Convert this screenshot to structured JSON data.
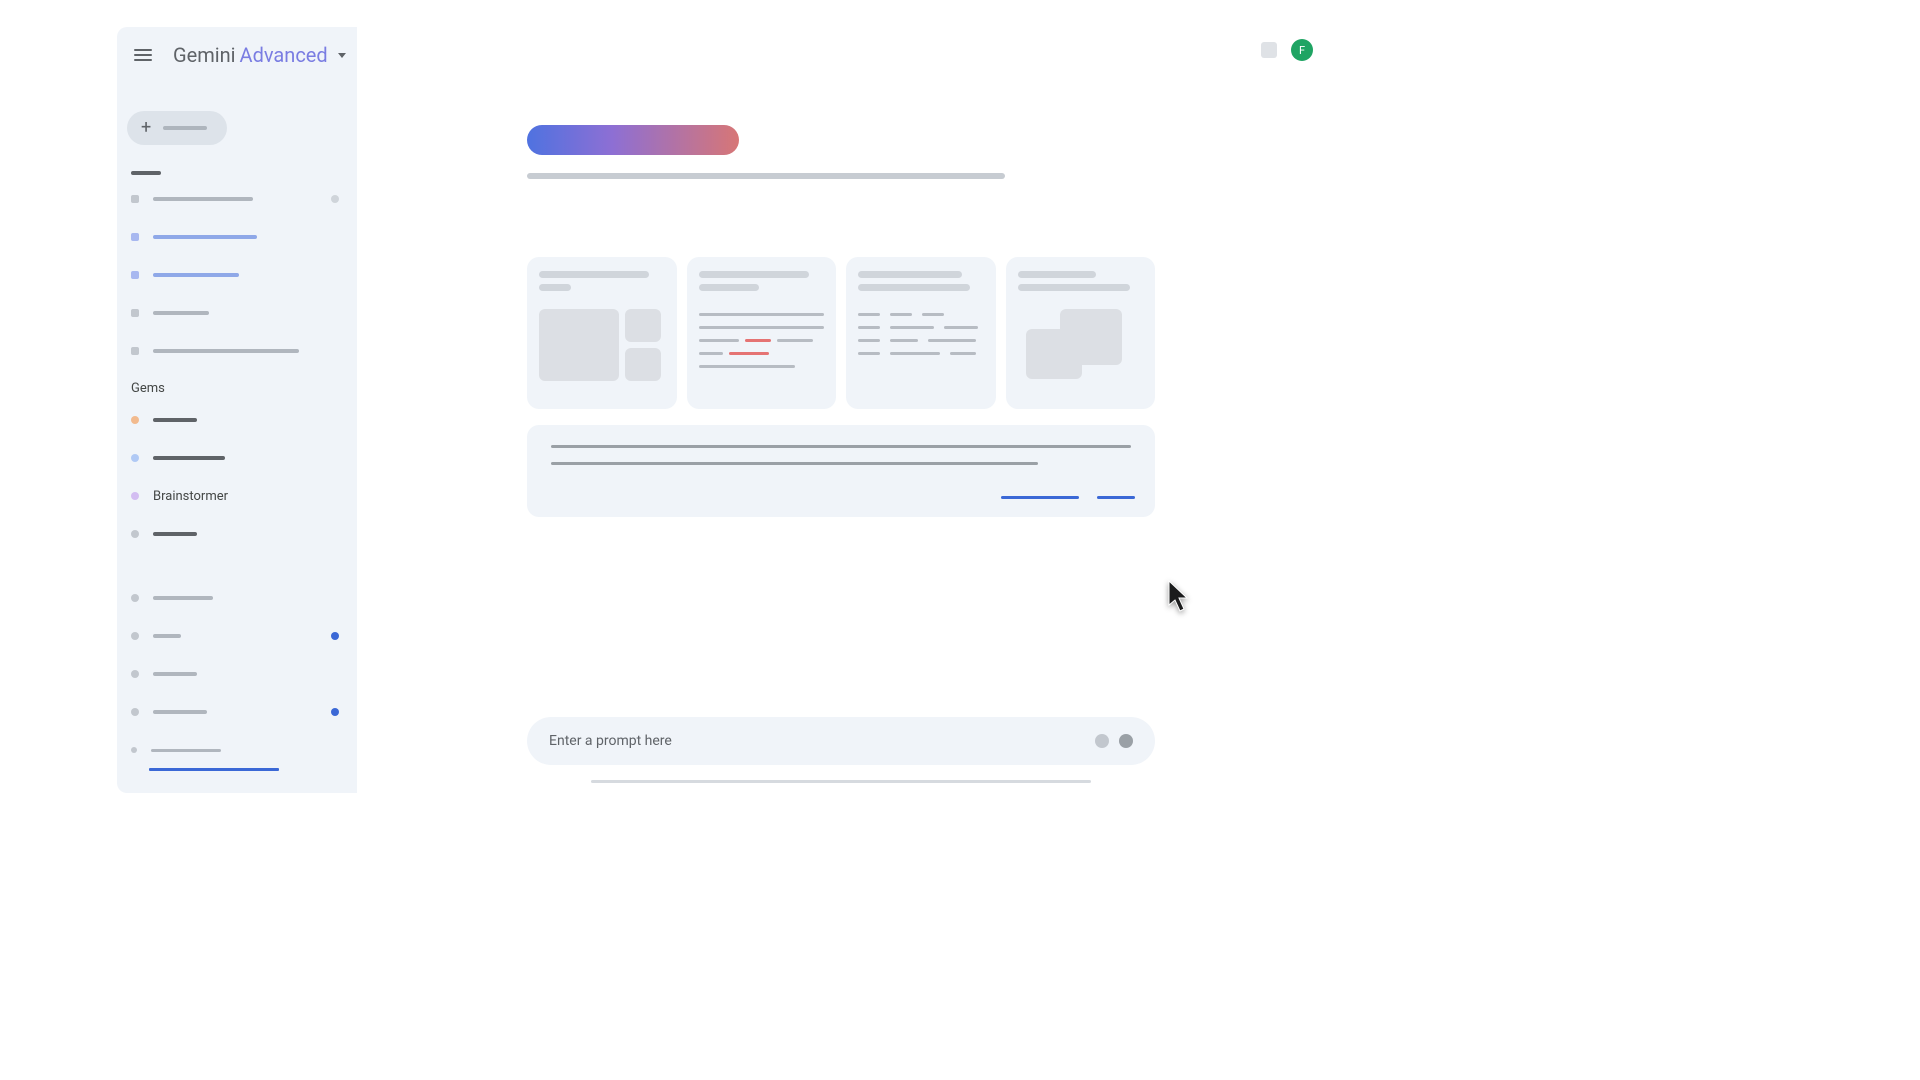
{
  "brand": {
    "name": "Gemini",
    "variant": "Advanced"
  },
  "sidebar": {
    "gems_header": "Gems",
    "gems": [
      {
        "label": "Brainstormer"
      }
    ]
  },
  "header": {
    "avatar_initial": "F"
  },
  "prompt": {
    "placeholder": "Enter a prompt here"
  },
  "colors": {
    "hero_gradient_start": "#4f72e0",
    "hero_gradient_end": "#d77676",
    "accent_blue": "#3b68d6",
    "avatar_green": "#1fa463"
  }
}
